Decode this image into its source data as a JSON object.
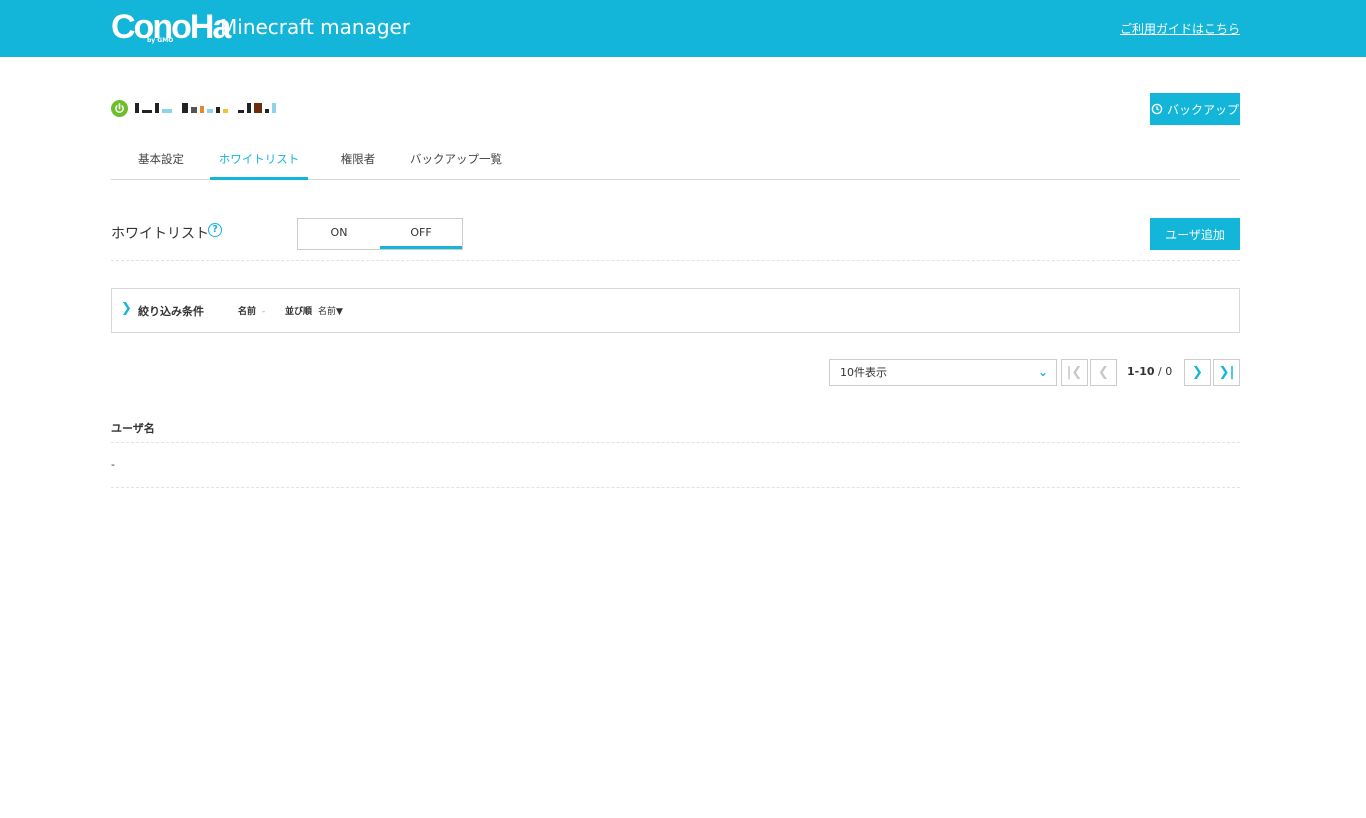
{
  "header": {
    "brand": "ConoHa",
    "brand_sub": "by GMO",
    "product": "Minecraft manager",
    "guide_link": "ご利用ガイドはこちら"
  },
  "server": {
    "status": "running",
    "backup_button": "バックアップ"
  },
  "tabs": [
    {
      "label": "基本設定",
      "active": false
    },
    {
      "label": "ホワイトリスト",
      "active": true
    },
    {
      "label": "権限者",
      "active": false
    },
    {
      "label": "バックアップ一覧",
      "active": false
    }
  ],
  "whitelist": {
    "label": "ホワイトリスト",
    "help": "?",
    "toggle_on": "ON",
    "toggle_off": "OFF",
    "selected": "OFF",
    "add_user_button": "ユーザ追加"
  },
  "filter": {
    "title": "絞り込み条件",
    "name_label": "名前",
    "name_value": "-",
    "sort_label": "並び順",
    "sort_value": "名前▼"
  },
  "pagination": {
    "per_page": "10件表示",
    "range": "1-10",
    "separator": "/",
    "total": "0"
  },
  "table": {
    "columns": [
      "ユーザ名"
    ],
    "rows": [
      [
        "-"
      ]
    ]
  },
  "colors": {
    "accent": "#13b6d9",
    "status_green": "#6cbf2a"
  }
}
